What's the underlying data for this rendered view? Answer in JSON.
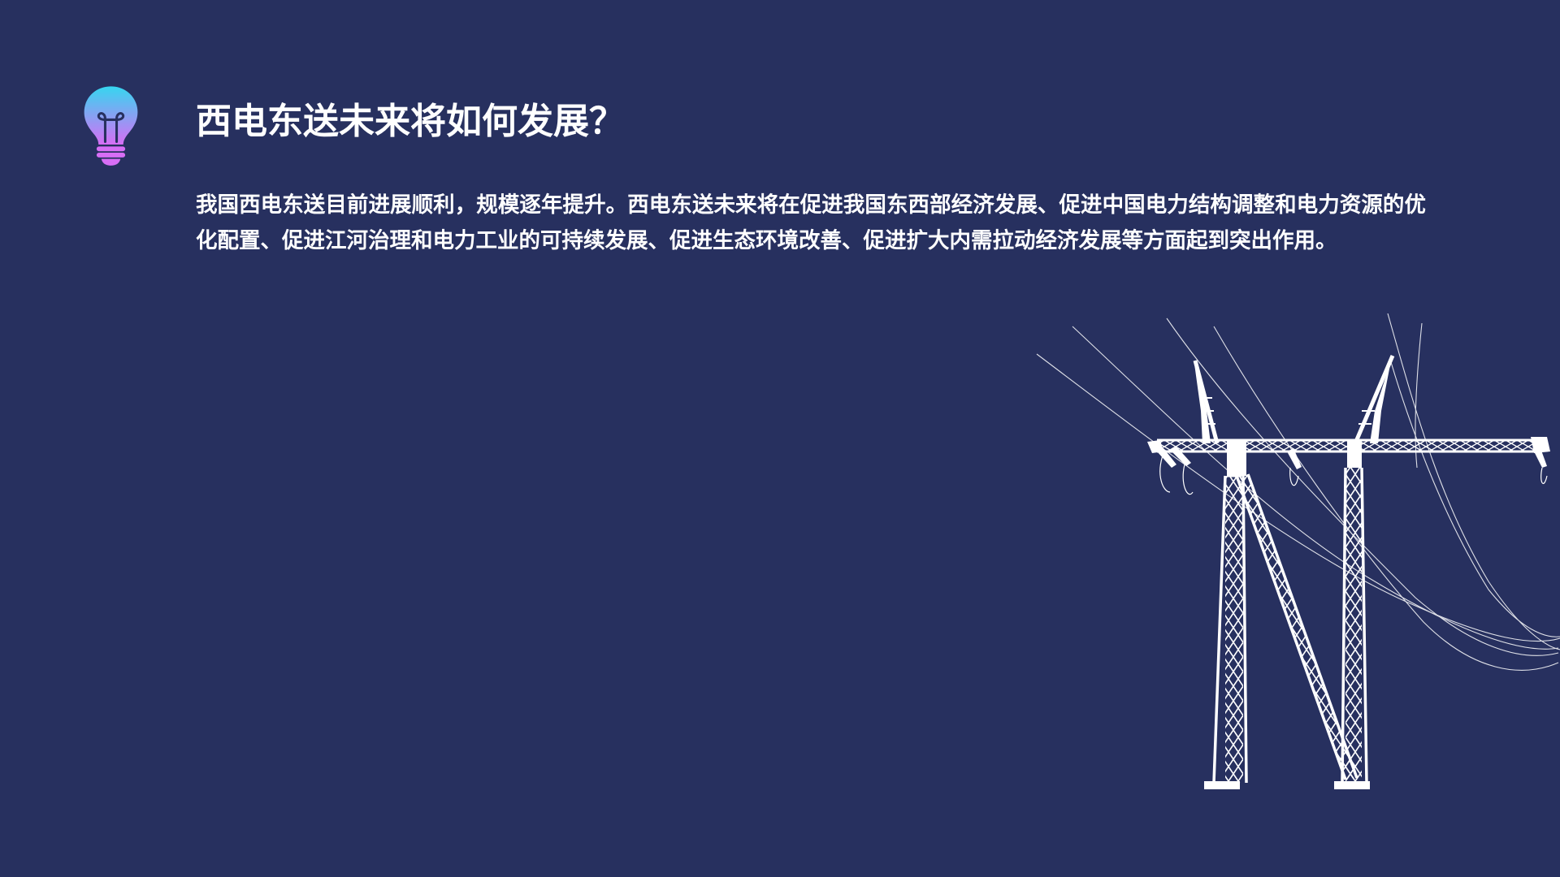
{
  "slide": {
    "background_color": "#27305f",
    "title": "西电东送未来将如何发展？",
    "body": "我国西电东送目前进展顺利，规模逐年提升。西电东送未来将在促进我国东西部经济发展、促进中国电力结构调整和电力资源的优化配置、促进江河治理和电力工业的可持续发展、促进生态环境改善、促进扩大内需拉动经济发展等方面起到突出作用。"
  },
  "icons": {
    "bulb": "lightbulb-icon",
    "pylon": "transmission-tower-illustration"
  },
  "colors": {
    "text": "#ffffff",
    "bulb_gradient_top": "#36d6f0",
    "bulb_gradient_bottom": "#d76ef5"
  }
}
